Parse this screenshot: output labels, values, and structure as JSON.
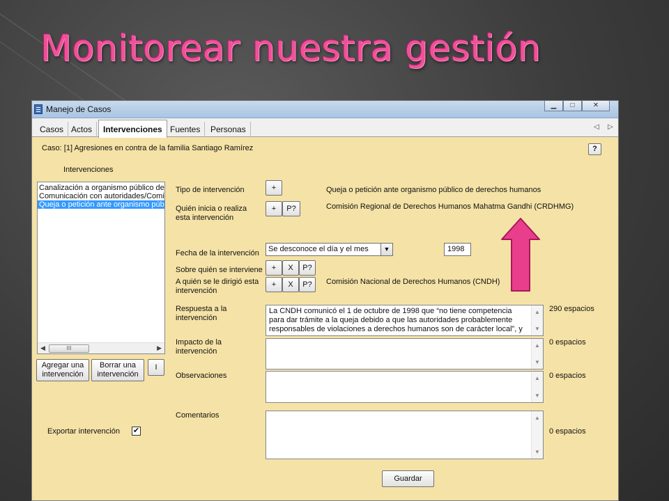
{
  "slide": {
    "title": "Monitorear nuestra gestión"
  },
  "window": {
    "title": "Manejo de Casos",
    "buttons": [
      "minimize",
      "maximize",
      "close"
    ]
  },
  "tabs": [
    "Casos",
    "Actos",
    "Intervenciones",
    "Fuentes",
    "Personas"
  ],
  "active_tab": "Intervenciones",
  "case_label": "Caso: [1] Agresiones en contra de la familia Santiago Ramírez",
  "help_label": "?",
  "list": {
    "header": "Intervenciones",
    "items": [
      "Canalización a organismo público de d",
      "Comunicación con autoridades/Comisi",
      "Queja o petición ante organismo públi"
    ],
    "selected_index": 2,
    "thumb_glyph": "III"
  },
  "buttons": {
    "add": "Agregar una intervención",
    "delete": "Borrar una intervención",
    "info": "I",
    "plus": "+",
    "x": "X",
    "p": "P?",
    "save": "Guardar"
  },
  "fields": {
    "tipo_label": "Tipo de intervención",
    "tipo_value": "Queja o petición ante organismo público de derechos humanos",
    "quien_label": "Quién inicia o realiza esta intervención",
    "quien_value": "Comisión Regional de Derechos Humanos Mahatma Gandhi (CRDHMG)",
    "fecha_label": "Fecha de la intervención",
    "fecha_select": "Se desconoce el día y el mes",
    "fecha_year": "1998",
    "sobre_label": "Sobre quién se interviene",
    "aquien_label": "A quién se le dirigió esta intervención",
    "aquien_value": "Comisión Nacional de Derechos Humanos (CNDH)",
    "respuesta_label": "Respuesta a la intervención",
    "respuesta_value": "La CNDH comunicó el 1 de octubre de 1998 que “no tiene competencia para dar trámite a la queja debido a que las autoridades probablemente responsables de violaciones a derechos humanos son de carácter local”, y",
    "respuesta_count": "290 espacios",
    "impacto_label": "Impacto de la intervención",
    "impacto_count": "0 espacios",
    "observaciones_label": "Observaciones",
    "observaciones_count": "0 espacios",
    "comentarios_label": "Comentarios",
    "comentarios_count": "0 espacios"
  },
  "export": {
    "label": "Exportar intervención",
    "checked": true,
    "mark": "✔"
  },
  "colors": {
    "title": "#f0509a",
    "window_bg": "#f5e2a6",
    "arrow": "#e83e8c",
    "selection": "#3399ff"
  }
}
